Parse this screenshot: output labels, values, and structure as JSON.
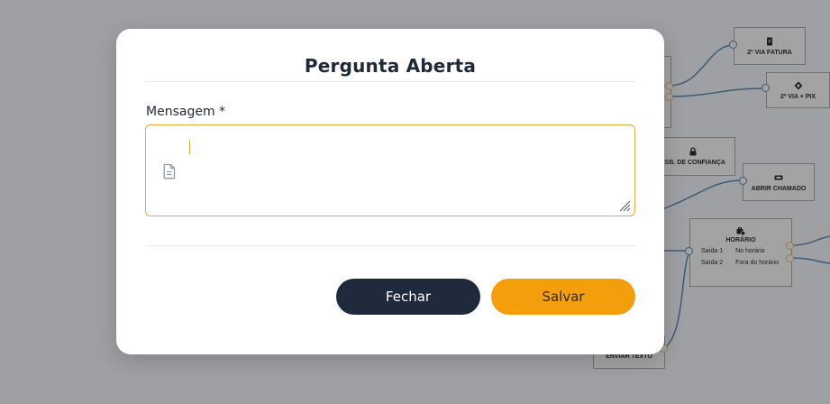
{
  "canvas": {
    "nodes": {
      "fatura": "2º VIA FATURA",
      "pix": "2º VIA + PIX",
      "confianca": "ESB. DE CONFIANÇA",
      "chamado": "ABRIR CHAMADO",
      "horario": {
        "title": "HORÁRIO",
        "rows": [
          {
            "exit": "Saída 1",
            "label": "No horário"
          },
          {
            "exit": "Saída 2",
            "label": "Fora do horário"
          }
        ]
      },
      "enviar": "ENVIAR TEXTO"
    }
  },
  "modal": {
    "title": "Pergunta Aberta",
    "field_label": "Mensagem *",
    "message_value": "",
    "close_label": "Fechar",
    "save_label": "Salvar"
  },
  "colors": {
    "primary_button": "#1f2a3c",
    "accent": "#f59e0b",
    "focus_border": "#e2a83a"
  }
}
